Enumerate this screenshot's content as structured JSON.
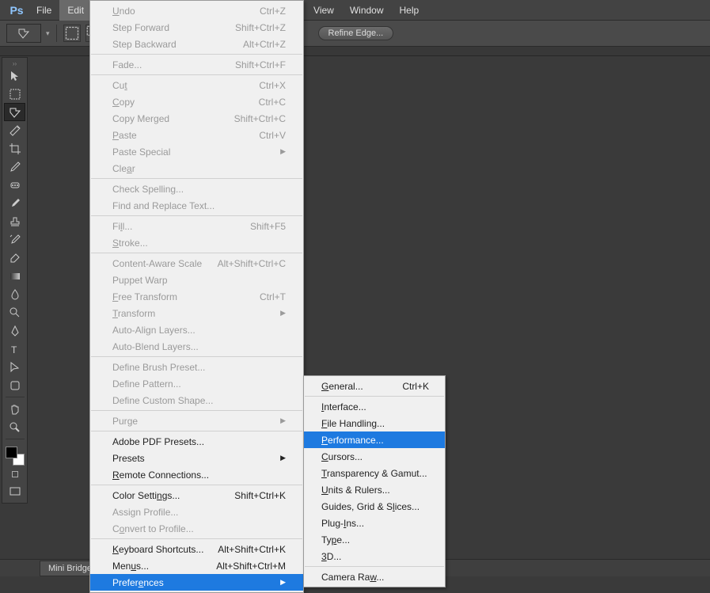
{
  "menubar": {
    "items": [
      "File",
      "Edit",
      "View",
      "Window",
      "Help"
    ]
  },
  "options_bar": {
    "refine_edge": "Refine Edge..."
  },
  "bottom_bar": {
    "mini_bridge": "Mini Bridge"
  },
  "edit_menu": {
    "groups": [
      [
        {
          "label": "Undo",
          "shortcut": "Ctrl+Z",
          "disabled": true,
          "u": 0
        },
        {
          "label": "Step Forward",
          "shortcut": "Shift+Ctrl+Z",
          "disabled": true
        },
        {
          "label": "Step Backward",
          "shortcut": "Alt+Ctrl+Z",
          "disabled": true
        }
      ],
      [
        {
          "label": "Fade...",
          "shortcut": "Shift+Ctrl+F",
          "disabled": true
        }
      ],
      [
        {
          "label": "Cut",
          "shortcut": "Ctrl+X",
          "disabled": true,
          "u": 2
        },
        {
          "label": "Copy",
          "shortcut": "Ctrl+C",
          "disabled": true,
          "u": 0
        },
        {
          "label": "Copy Merged",
          "shortcut": "Shift+Ctrl+C",
          "disabled": true
        },
        {
          "label": "Paste",
          "shortcut": "Ctrl+V",
          "disabled": true,
          "u": 0
        },
        {
          "label": "Paste Special",
          "submenu": true,
          "disabled": true
        },
        {
          "label": "Clear",
          "disabled": true,
          "u": 3
        }
      ],
      [
        {
          "label": "Check Spelling...",
          "disabled": true
        },
        {
          "label": "Find and Replace Text...",
          "disabled": true
        }
      ],
      [
        {
          "label": "Fill...",
          "shortcut": "Shift+F5",
          "disabled": true,
          "u": 2
        },
        {
          "label": "Stroke...",
          "disabled": true,
          "u": 0
        }
      ],
      [
        {
          "label": "Content-Aware Scale",
          "shortcut": "Alt+Shift+Ctrl+C",
          "disabled": true
        },
        {
          "label": "Puppet Warp",
          "disabled": true
        },
        {
          "label": "Free Transform",
          "shortcut": "Ctrl+T",
          "disabled": true,
          "u": 0
        },
        {
          "label": "Transform",
          "submenu": true,
          "disabled": true,
          "u": 0
        },
        {
          "label": "Auto-Align Layers...",
          "disabled": true
        },
        {
          "label": "Auto-Blend Layers...",
          "disabled": true
        }
      ],
      [
        {
          "label": "Define Brush Preset...",
          "disabled": true
        },
        {
          "label": "Define Pattern...",
          "disabled": true
        },
        {
          "label": "Define Custom Shape...",
          "disabled": true
        }
      ],
      [
        {
          "label": "Purge",
          "submenu": true,
          "disabled": true,
          "u": 3
        }
      ],
      [
        {
          "label": "Adobe PDF Presets..."
        },
        {
          "label": "Presets",
          "submenu": true
        },
        {
          "label": "Remote Connections...",
          "u": 0
        }
      ],
      [
        {
          "label": "Color Settings...",
          "shortcut": "Shift+Ctrl+K",
          "u": 11
        },
        {
          "label": "Assign Profile...",
          "disabled": true
        },
        {
          "label": "Convert to Profile...",
          "disabled": true,
          "u": 1
        }
      ],
      [
        {
          "label": "Keyboard Shortcuts...",
          "shortcut": "Alt+Shift+Ctrl+K",
          "u": 0
        },
        {
          "label": "Menus...",
          "shortcut": "Alt+Shift+Ctrl+M",
          "u": 3
        },
        {
          "label": "Preferences",
          "submenu": true,
          "highlight": true,
          "u": 6
        }
      ]
    ]
  },
  "pref_submenu": {
    "groups": [
      [
        {
          "label": "General...",
          "shortcut": "Ctrl+K",
          "u": 0
        }
      ],
      [
        {
          "label": "Interface...",
          "u": 0
        },
        {
          "label": "File Handling...",
          "u": 0
        },
        {
          "label": "Performance...",
          "highlight": true,
          "u": 0
        },
        {
          "label": "Cursors...",
          "u": 0
        },
        {
          "label": "Transparency & Gamut...",
          "u": 0
        },
        {
          "label": "Units & Rulers...",
          "u": 0
        },
        {
          "label": "Guides, Grid & Slices...",
          "u": 16
        },
        {
          "label": "Plug-Ins...",
          "u": 5
        },
        {
          "label": "Type...",
          "u": 2
        },
        {
          "label": "3D...",
          "u": 0
        }
      ],
      [
        {
          "label": "Camera Raw...",
          "u": 9
        }
      ]
    ]
  },
  "tools": [
    "move",
    "marquee",
    "lasso",
    "wand",
    "crop",
    "eyedropper",
    "heal",
    "brush",
    "stamp",
    "history",
    "eraser",
    "gradient",
    "blur",
    "dodge",
    "pen",
    "type",
    "path",
    "shape",
    "hand",
    "zoom"
  ]
}
